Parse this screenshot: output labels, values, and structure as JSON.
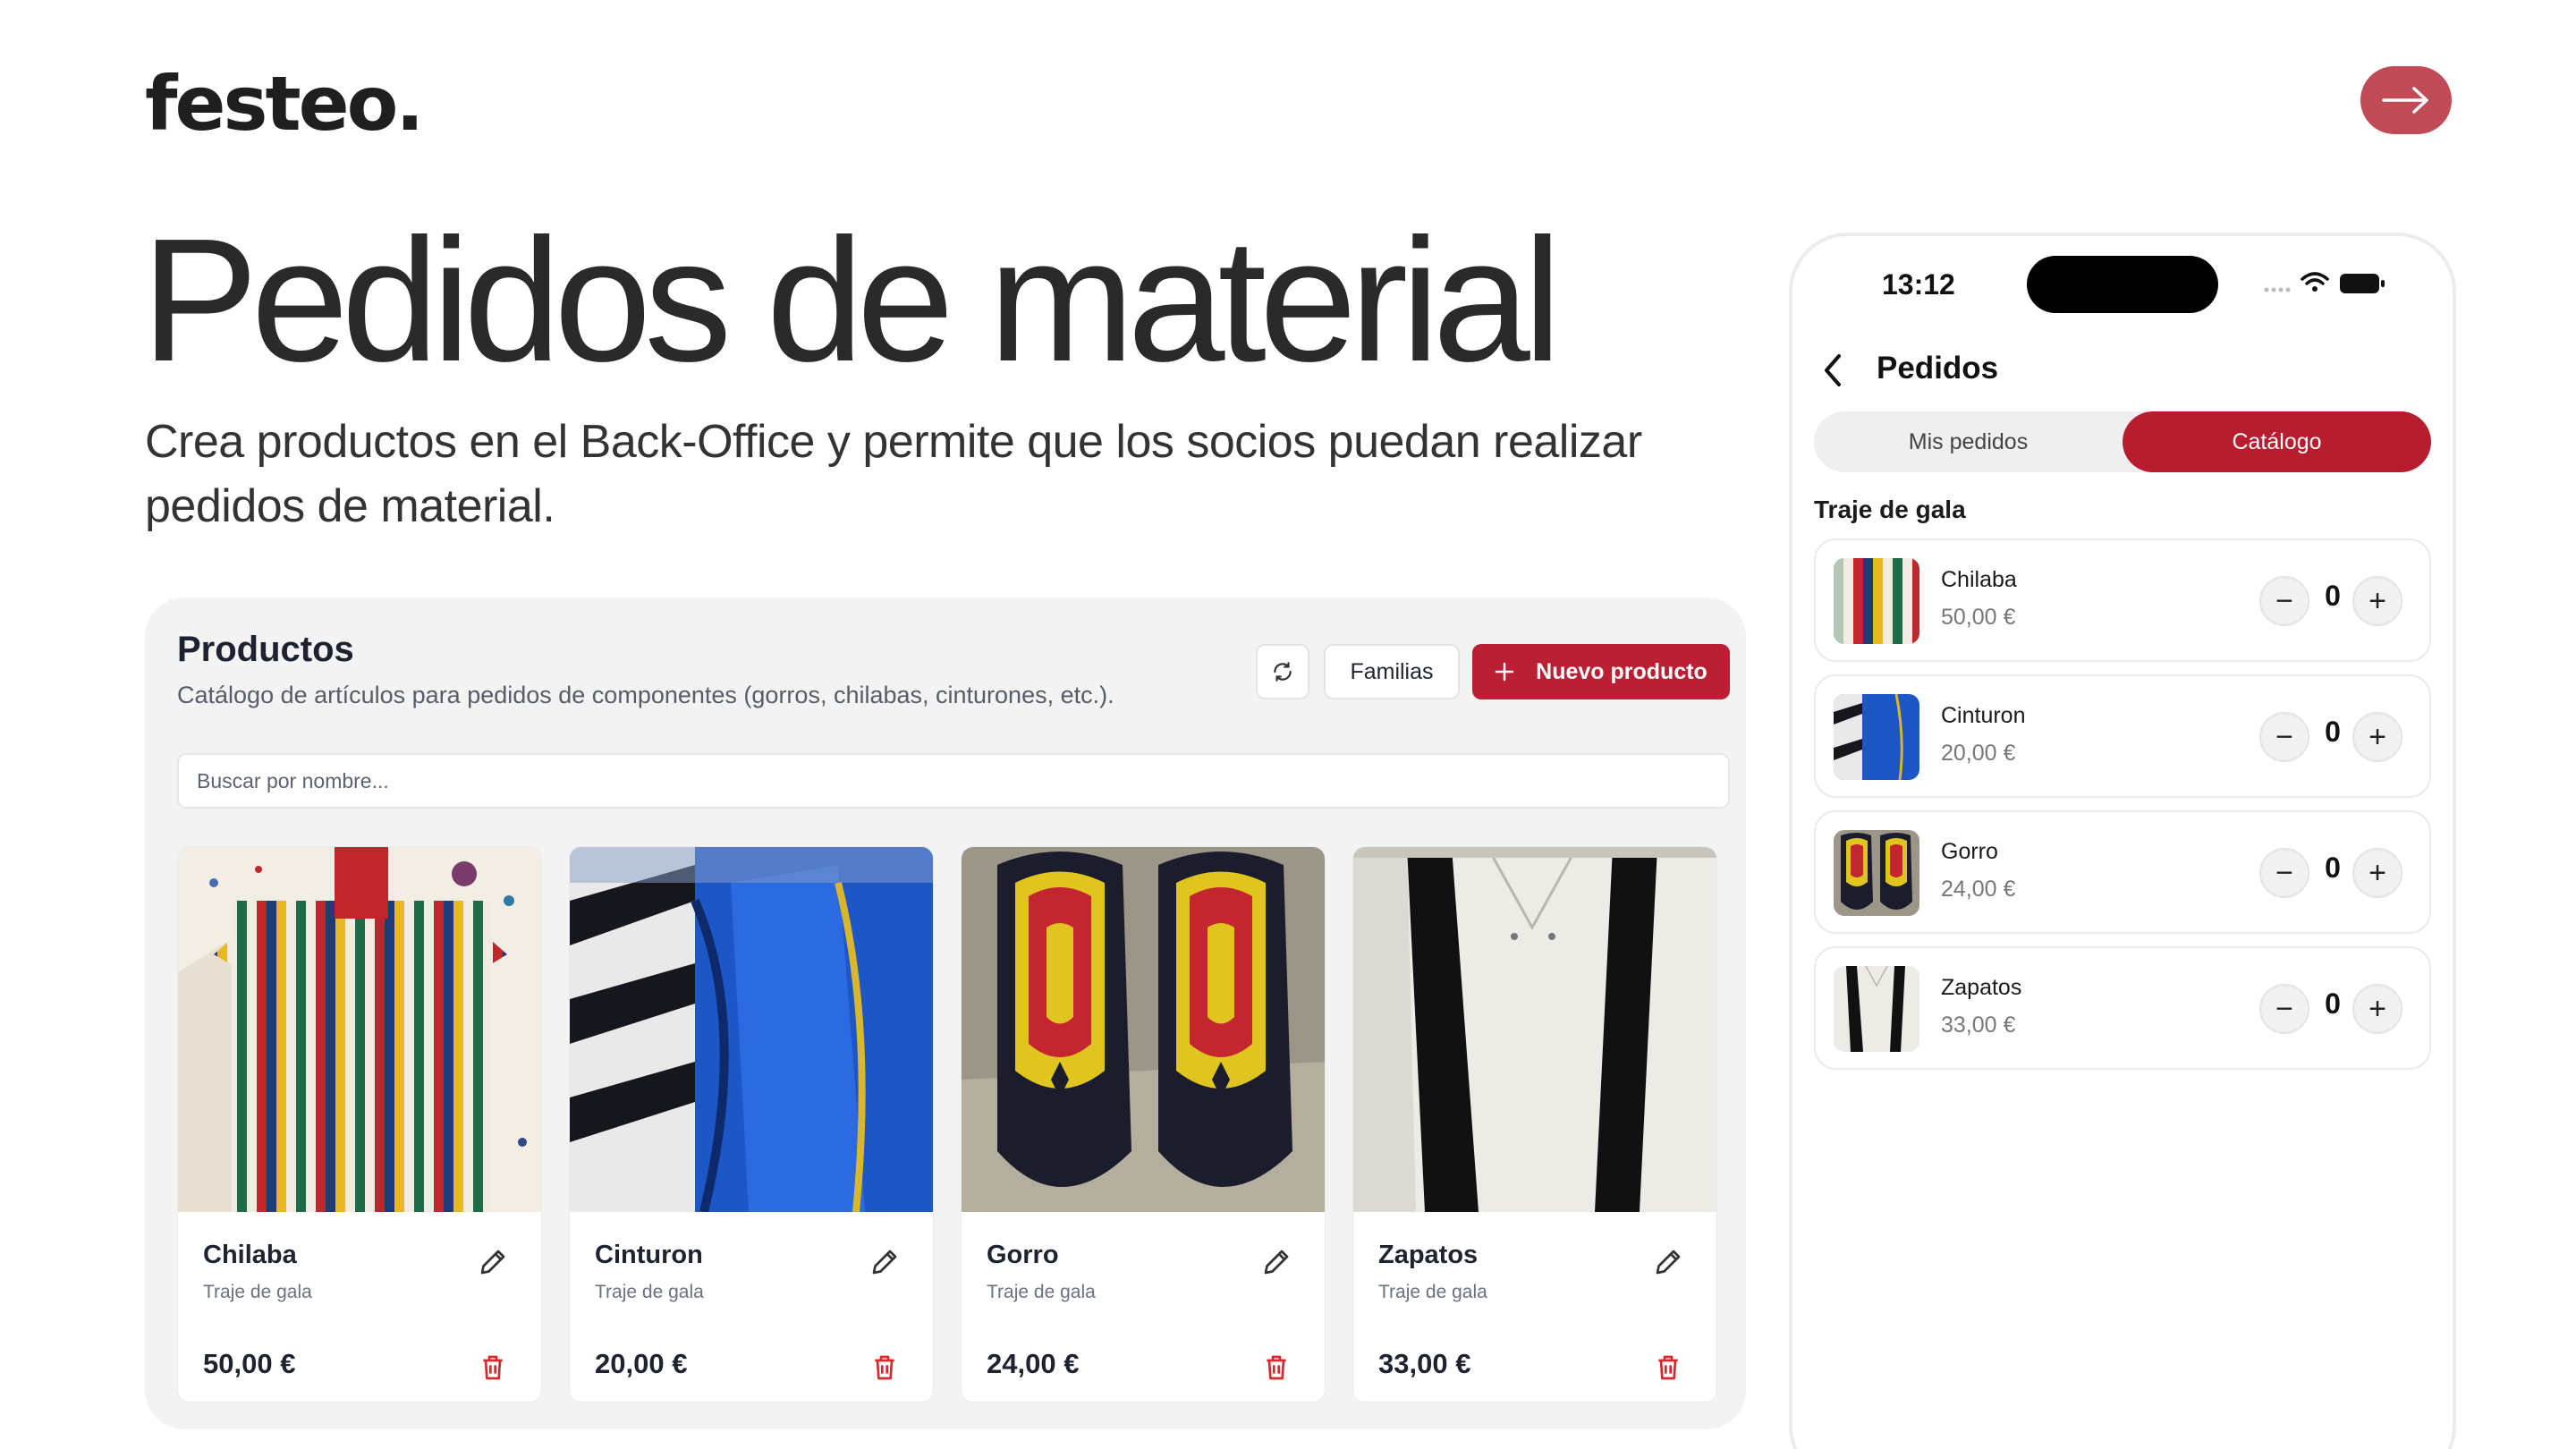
{
  "brand": {
    "logo": "festeo."
  },
  "hero": {
    "title": "Pedidos de material",
    "subtitle": "Crea productos en el Back-Office y permite que los socios puedan realizar pedidos de material."
  },
  "backoffice": {
    "title": "Productos",
    "description": "Catálogo de artículos para pedidos de componentes (gorros, chilabas, cinturones, etc.).",
    "familias_label": "Familias",
    "new_product_label": "Nuevo producto",
    "search_placeholder": "Buscar por nombre...",
    "products": [
      {
        "name": "Chilaba",
        "family": "Traje de gala",
        "price": "50,00 €"
      },
      {
        "name": "Cinturon",
        "family": "Traje de gala",
        "price": "20,00 €"
      },
      {
        "name": "Gorro",
        "family": "Traje de gala",
        "price": "24,00 €"
      },
      {
        "name": "Zapatos",
        "family": "Traje de gala",
        "price": "33,00 €"
      }
    ]
  },
  "phone": {
    "time": "13:12",
    "nav_title": "Pedidos",
    "tabs": [
      {
        "label": "Mis pedidos",
        "active": false
      },
      {
        "label": "Catálogo",
        "active": true
      }
    ],
    "section": "Traje de gala",
    "items": [
      {
        "name": "Chilaba",
        "price": "50,00 €",
        "qty": "0"
      },
      {
        "name": "Cinturon",
        "price": "20,00 €",
        "qty": "0"
      },
      {
        "name": "Gorro",
        "price": "24,00 €",
        "qty": "0"
      },
      {
        "name": "Zapatos",
        "price": "33,00 €",
        "qty": "0"
      }
    ]
  },
  "colors": {
    "accent": "#bb1f34",
    "next_button": "#c04b57",
    "panel_bg": "#f3f3f3"
  },
  "icons": [
    "arrow-right-icon",
    "refresh-icon",
    "plus-icon",
    "pencil-icon",
    "trash-icon",
    "chevron-left-icon",
    "wifi-icon",
    "battery-icon"
  ]
}
